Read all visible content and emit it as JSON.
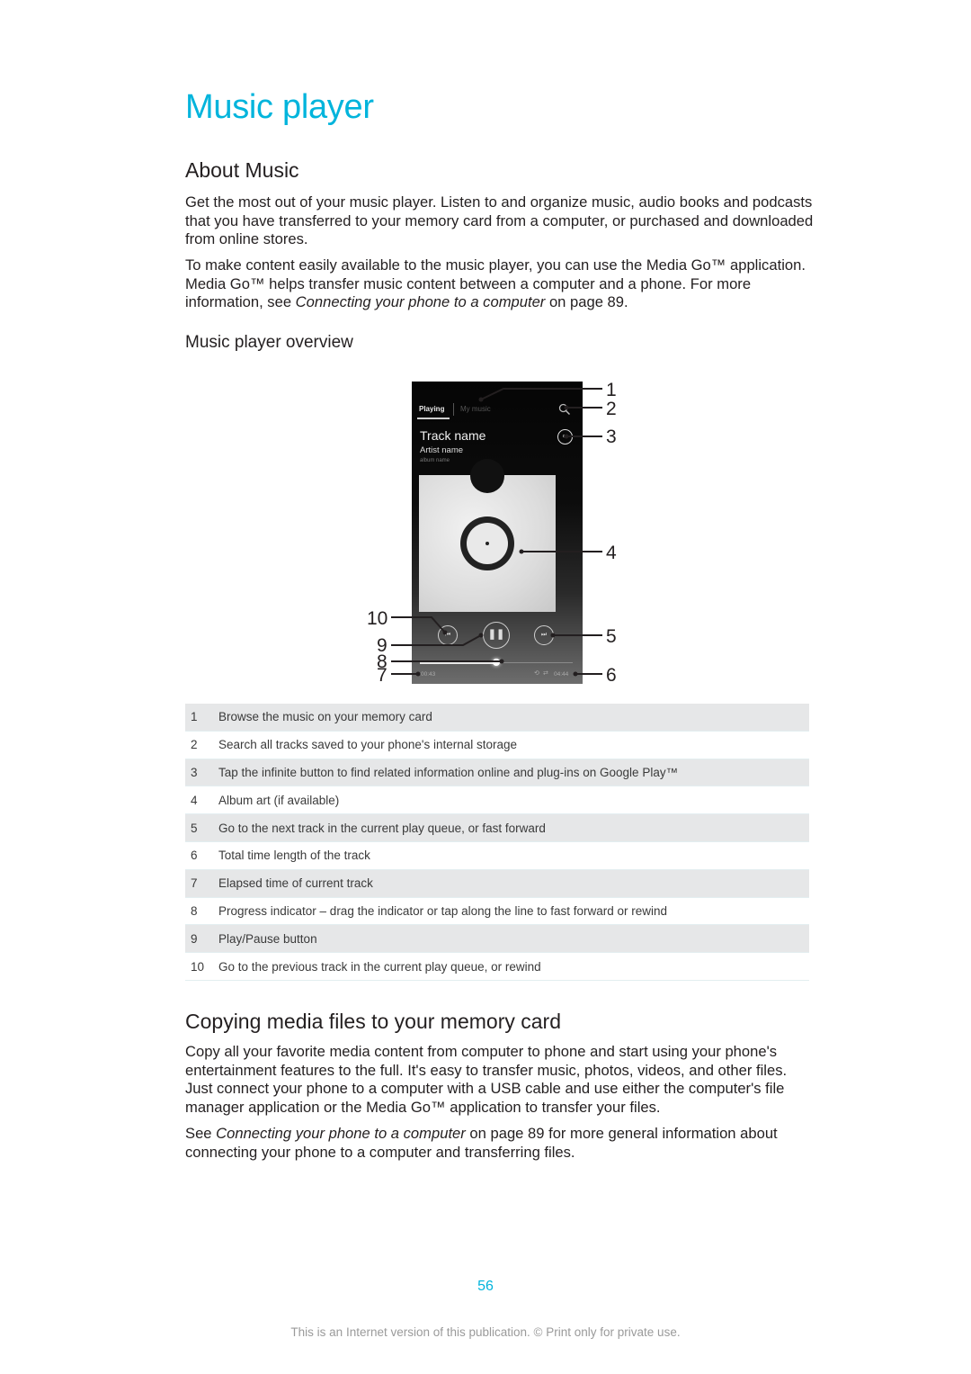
{
  "page": {
    "title": "Music player",
    "page_number": "56",
    "footer": "This is an Internet version of this publication. © Print only for private use."
  },
  "about": {
    "heading": "About Music",
    "paragraph1": "Get the most out of your music player. Listen to and organize music, audio books and podcasts that you have transferred to your memory card from a computer, or purchased and downloaded from online stores.",
    "paragraph2_before": "To make content easily available to the music player, you can use the Media Go™ application. Media Go™ helps transfer music content between a computer and a phone. For more information, see ",
    "paragraph2_link": "Connecting your phone to a computer",
    "paragraph2_after": " on page 89."
  },
  "overview": {
    "heading": "Music player overview",
    "screenshot": {
      "tab_playing": "Playing",
      "tab_my_music": "My music",
      "track_name": "Track name",
      "artist_name": "Artist name",
      "album_name": "album name",
      "elapsed_time": "00:43",
      "total_time": "04:44",
      "progress_fraction": 0.5,
      "icons": {
        "search": "🔍",
        "infinite": "∞",
        "previous": "⏮",
        "pause": "❚❚",
        "next": "⏭",
        "repeat": "⟲",
        "shuffle": "⇄"
      }
    },
    "callouts": [
      "1",
      "2",
      "3",
      "4",
      "5",
      "6",
      "7",
      "8",
      "9",
      "10"
    ],
    "legend": [
      {
        "num": "1",
        "text": "Browse the music on your memory card"
      },
      {
        "num": "2",
        "text": "Search all tracks saved to your phone's internal storage"
      },
      {
        "num": "3",
        "text": "Tap the infinite button to find related information online and plug-ins on Google Play™"
      },
      {
        "num": "4",
        "text": "Album art (if available)"
      },
      {
        "num": "5",
        "text": "Go to the next track in the current play queue, or fast forward"
      },
      {
        "num": "6",
        "text": "Total time length of the track"
      },
      {
        "num": "7",
        "text": "Elapsed time of current track"
      },
      {
        "num": "8",
        "text": "Progress indicator – drag the indicator or tap along the line to fast forward or rewind"
      },
      {
        "num": "9",
        "text": "Play/Pause button"
      },
      {
        "num": "10",
        "text": "Go to the previous track in the current play queue, or rewind"
      }
    ]
  },
  "copying": {
    "heading": "Copying media files to your memory card",
    "paragraph1": "Copy all your favorite media content from computer to phone and start using your phone's entertainment features to the full. It's easy to transfer music, photos, videos, and other files. Just connect your phone to a computer with a USB cable and use either the computer's file manager application or the Media Go™ application to transfer your files.",
    "paragraph2_before": "See ",
    "paragraph2_link": "Connecting your phone to a computer",
    "paragraph2_after": " on page 89 for more general information about connecting your phone to a computer and transferring files."
  },
  "colors": {
    "accent": "#00b4dc",
    "body_text": "#231f20",
    "table_shade": "#e6e7e8",
    "footer_text": "#9a9a9a"
  }
}
